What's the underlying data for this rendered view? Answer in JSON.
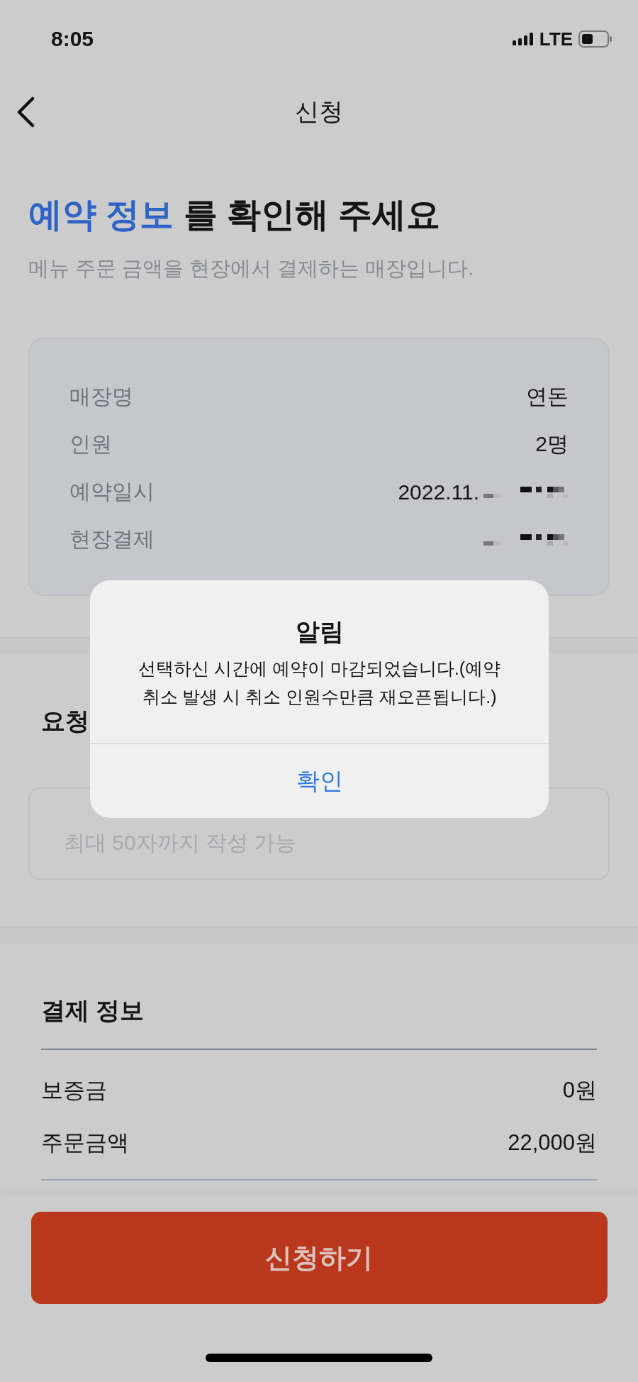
{
  "status_bar": {
    "time": "8:05",
    "network": "LTE"
  },
  "nav": {
    "title": "신청"
  },
  "heading": {
    "highlight": "예약 정보",
    "rest": "를 확인해 주세요"
  },
  "subtitle": "메뉴 주문 금액을 현장에서 결제하는 매장입니다.",
  "reservation": [
    {
      "label": "매장명",
      "value": "연돈"
    },
    {
      "label": "인원",
      "value": "2명"
    },
    {
      "label": "예약일시",
      "value": "2022.11.",
      "redacted": true
    },
    {
      "label": "현장결제",
      "redacted": true
    }
  ],
  "request": {
    "label": "요청",
    "placeholder": "최대 50자까지 작성 가능"
  },
  "payment": {
    "title": "결제 정보",
    "rows": [
      {
        "label": "보증금",
        "value": "0원"
      },
      {
        "label": "주문금액",
        "value": "22,000원"
      }
    ]
  },
  "submit": "신청하기",
  "alert": {
    "title": "알림",
    "message": "선택하신 시간에 예약이 마감되었습니다.(예약 취소 발생 시 취소 인원수만큼 재오픈됩니다.)",
    "button": "확인"
  }
}
